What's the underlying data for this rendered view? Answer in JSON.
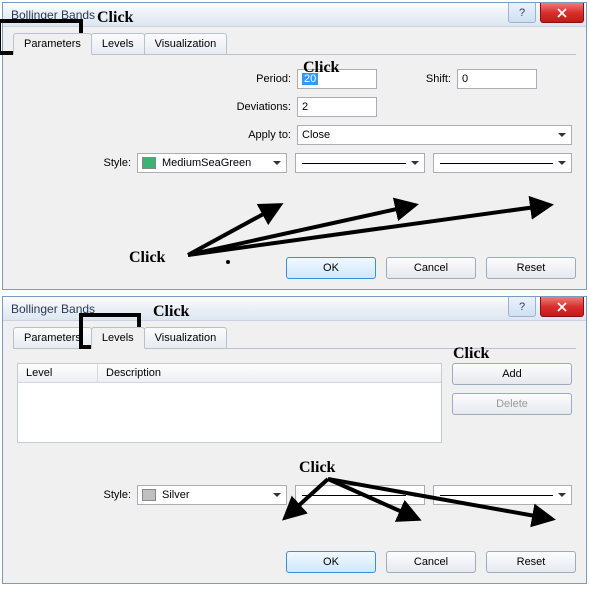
{
  "dialog1": {
    "title": "Bollinger Bands",
    "tabs": {
      "parameters": "Parameters",
      "levels": "Levels",
      "visualization": "Visualization"
    },
    "labels": {
      "period": "Period:",
      "shift": "Shift:",
      "deviations": "Deviations:",
      "apply_to": "Apply to:",
      "style": "Style:"
    },
    "values": {
      "period": "20",
      "shift": "0",
      "deviations": "2",
      "apply_to": "Close",
      "style_color": "MediumSeaGreen"
    },
    "buttons": {
      "ok": "OK",
      "cancel": "Cancel",
      "reset": "Reset"
    }
  },
  "dialog2": {
    "title": "Bollinger Bands",
    "tabs": {
      "parameters": "Parameters",
      "levels": "Levels",
      "visualization": "Visualization"
    },
    "table": {
      "col_level": "Level",
      "col_description": "Description"
    },
    "labels": {
      "style": "Style:"
    },
    "values": {
      "style_color": "Silver"
    },
    "buttons": {
      "add": "Add",
      "delete": "Delete",
      "ok": "OK",
      "cancel": "Cancel",
      "reset": "Reset"
    }
  },
  "annotations": {
    "click": "Click"
  }
}
